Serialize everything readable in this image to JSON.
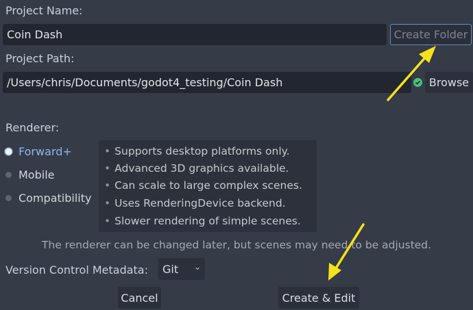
{
  "project_name": {
    "label": "Project Name:",
    "value": "Coin Dash",
    "create_folder_label": "Create Folder"
  },
  "project_path": {
    "label": "Project Path:",
    "value": "/Users/chris/Documents/godot4_testing/Coin Dash",
    "status_icon": "check-circle-icon",
    "browse_label": "Browse"
  },
  "renderer": {
    "label": "Renderer:",
    "options": [
      {
        "label": "Forward+",
        "selected": true
      },
      {
        "label": "Mobile",
        "selected": false
      },
      {
        "label": "Compatibility",
        "selected": false
      }
    ],
    "features": [
      "Supports desktop platforms only.",
      "Advanced 3D graphics available.",
      "Can scale to large complex scenes.",
      "Uses RenderingDevice backend.",
      "Slower rendering of simple scenes."
    ],
    "note": "The renderer can be changed later, but scenes may need to be adjusted."
  },
  "vcs": {
    "label": "Version Control Metadata:",
    "value": "Git"
  },
  "buttons": {
    "cancel": "Cancel",
    "create_edit": "Create & Edit"
  },
  "colors": {
    "background": "#353b47",
    "field": "#22262e",
    "accent": "#8bb8f0",
    "annotation_arrow": "#f5e21b",
    "valid": "#45c17a"
  }
}
